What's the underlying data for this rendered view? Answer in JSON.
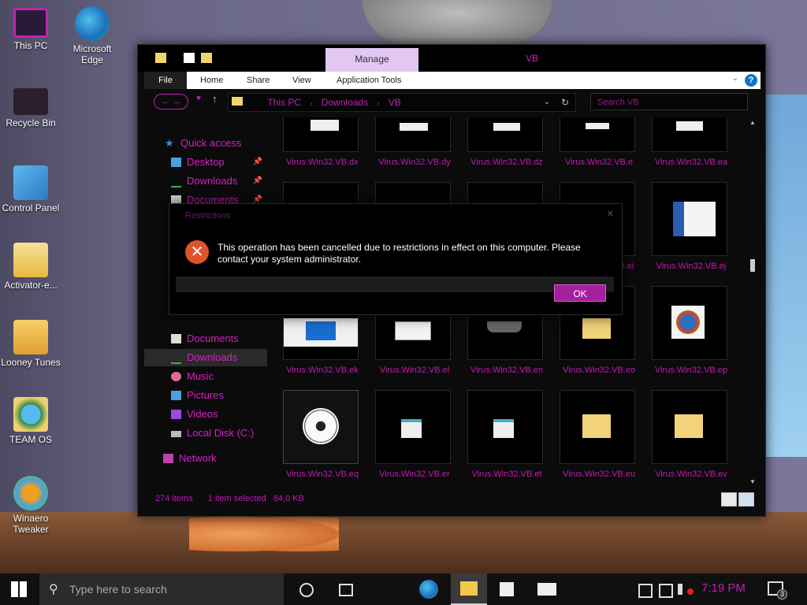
{
  "desktop": {
    "icons": [
      {
        "label": "This PC",
        "icon": "monitor-icon"
      },
      {
        "label": "Microsoft Edge",
        "icon": "edge-icon"
      },
      {
        "label": "Recycle Bin",
        "icon": "recycle-bin-icon"
      },
      {
        "label": "Control Panel",
        "icon": "control-panel-icon"
      },
      {
        "label": "Activator-e...",
        "icon": "folder-icon"
      },
      {
        "label": "Looney Tunes",
        "icon": "folder-icon"
      },
      {
        "label": "TEAM OS",
        "icon": "globe-icon"
      },
      {
        "label": "Winaero Tweaker",
        "icon": "winaero-icon"
      }
    ]
  },
  "explorer": {
    "window_title": "VB",
    "contextual_tab": "Manage",
    "ribbon_tabs": [
      "File",
      "Home",
      "Share",
      "View",
      "Application Tools"
    ],
    "help": "?",
    "address": {
      "segments": [
        "This PC",
        "Downloads",
        "VB"
      ]
    },
    "search_placeholder": "Search VB",
    "nav": {
      "quick_access": "Quick access",
      "items": [
        "Desktop",
        "Downloads",
        "Documents",
        "Documents",
        "Downloads",
        "Music",
        "Pictures",
        "Videos",
        "Local Disk (C:)",
        "Network"
      ]
    },
    "files": [
      [
        "Virus.Win32.VB.dx",
        "Virus.Win32.VB.dy",
        "Virus.Win32.VB.dz",
        "Virus.Win32.VB.e",
        "Virus.Win32.VB.ea"
      ],
      [
        "",
        "",
        "",
        "Virus.Win32.VB.ei",
        "Virus.Win32.VB.ej"
      ],
      [
        "Virus.Win32.VB.ek",
        "Virus.Win32.VB.el",
        "Virus.Win32.VB.en",
        "Virus.Win32.VB.eo",
        "Virus.Win32.VB.ep"
      ],
      [
        "Virus.Win32.VB.eq",
        "Virus.Win32.VB.er",
        "Virus.Win32.VB.et",
        "Virus.Win32.VB.eu",
        "Virus.Win32.VB.ev"
      ]
    ],
    "status": {
      "count": "274 items",
      "selected": "1 item selected",
      "size": "84,0 KB"
    }
  },
  "dialog": {
    "title": "Restrictions",
    "message": "This operation has been cancelled due to restrictions in effect on this computer. Please contact your system administrator.",
    "ok": "OK"
  },
  "taskbar": {
    "search_placeholder": "Type here to search",
    "time": "7:19 PM",
    "notification_count": "3"
  },
  "colors": {
    "accent": "#c01ab3",
    "dialog_button": "#a5209e",
    "manage_tab": "#e2c7f3"
  }
}
